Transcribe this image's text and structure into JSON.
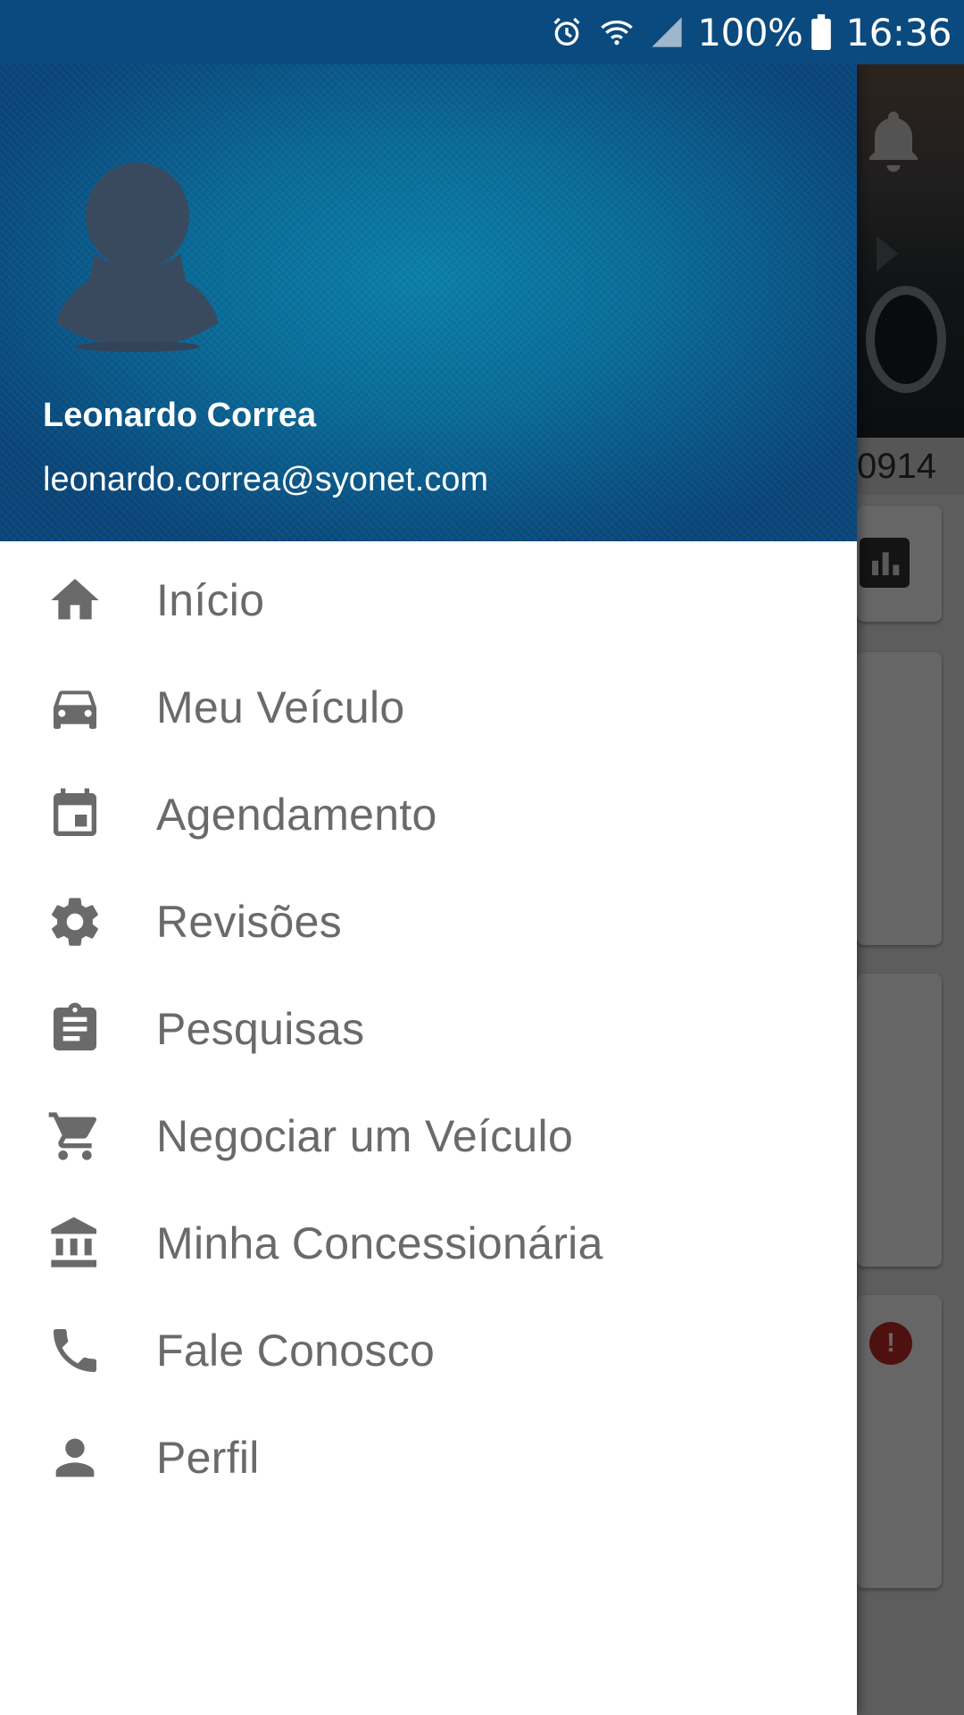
{
  "status_bar": {
    "battery_percent": "100%",
    "time": "16:36",
    "icons": [
      "alarm-icon",
      "wifi-icon",
      "cell-signal-icon",
      "battery-icon"
    ]
  },
  "drawer": {
    "user": {
      "name": "Leonardo Correa",
      "email": "leonardo.correa@syonet.com"
    },
    "menu": [
      {
        "label": "Início",
        "icon": "home-icon"
      },
      {
        "label": "Meu Veículo",
        "icon": "car-icon"
      },
      {
        "label": "Agendamento",
        "icon": "calendar-icon"
      },
      {
        "label": "Revisões",
        "icon": "gear-icon"
      },
      {
        "label": "Pesquisas",
        "icon": "clipboard-icon"
      },
      {
        "label": "Negociar um Veículo",
        "icon": "cart-icon"
      },
      {
        "label": "Minha Concessionária",
        "icon": "bank-icon"
      },
      {
        "label": "Fale Conosco",
        "icon": "phone-icon"
      },
      {
        "label": "Perfil",
        "icon": "person-icon"
      }
    ]
  },
  "background": {
    "partial_text": "0914"
  },
  "colors": {
    "status_bar": "#0a4a7e",
    "header_center": "#0b80a8",
    "menu_text": "#6a6a6a",
    "alert": "#c62828"
  }
}
